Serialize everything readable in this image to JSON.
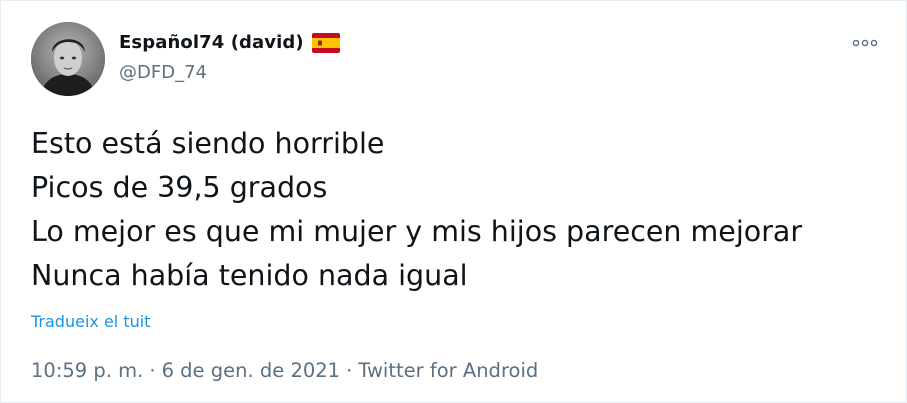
{
  "user": {
    "display_name": "Español74 (david)",
    "handle": "@DFD_74",
    "flag_icon": "spain-flag-icon",
    "avatar_icon": "profile-photo"
  },
  "more_icon": "more-options-icon",
  "tweet": {
    "lines": [
      "Esto está siendo horrible",
      "Picos de 39,5 grados",
      "Lo mejor es que mi mujer y mis hijos parecen mejorar",
      "Nunca había tenido nada igual"
    ],
    "translate_label": "Tradueix el tuit"
  },
  "meta": {
    "time": "10:59 p. m.",
    "separator": "·",
    "date": "6 de gen. de 2021",
    "source": "Twitter for Android"
  },
  "colors": {
    "text": "#0f1419",
    "secondary": "#5b7083",
    "link": "#1b95e0",
    "border": "#e6ecf0"
  }
}
